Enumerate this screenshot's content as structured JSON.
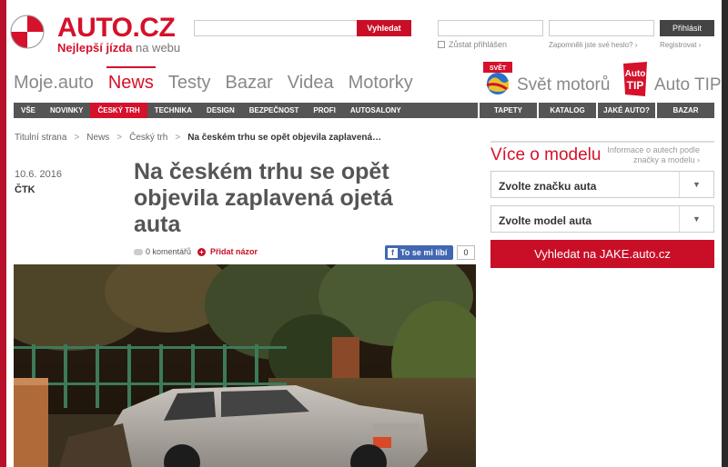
{
  "header": {
    "logo_text": "AUTO.CZ",
    "tagline_bold": "Nejlepší jízda",
    "tagline_light": " na webu",
    "search_button": "Vyhledat",
    "login_button": "Přihlásit",
    "remember_label": "Zůstat přihlášen",
    "forgot_label": "Zapomněli jste své heslo? ›",
    "register_label": "Registrovat ›"
  },
  "main_nav": {
    "items": [
      "Moje.auto",
      "News",
      "Testy",
      "Bazar",
      "Videa",
      "Motorky"
    ],
    "active": "News",
    "svet_label": "Svět motorů",
    "svet_logo_top": "SVĚT",
    "autotip_label": "Auto TIP",
    "autotip_logo_top": "Auto",
    "autotip_logo_bottom": "TIP"
  },
  "sub_nav": {
    "items": [
      "VŠE",
      "NOVINKY",
      "ČESKÝ TRH",
      "TECHNIKA",
      "DESIGN",
      "BEZPEČNOST",
      "PROFI",
      "AUTOSALONY"
    ],
    "active": "ČESKÝ TRH",
    "right_items": [
      "TAPETY",
      "KATALOG",
      "JAKÉ AUTO?",
      "BAZAR"
    ]
  },
  "breadcrumb": {
    "items": [
      "Titulní strana",
      "News",
      "Český trh"
    ],
    "current": "Na českém trhu se opět objevila zaplavená…"
  },
  "article": {
    "date": "10.6. 2016",
    "author": "ČTK",
    "title": "Na českém trhu se opět objevila zaplavená ojetá auta",
    "comments": "0 komentářů",
    "add_opinion": "Přidat názor",
    "like_label": "To se mi líbí",
    "like_count": "0"
  },
  "sidebar": {
    "title": "Více o modelu",
    "info": "Informace o autech podle značky a modelu ›",
    "brand_select": "Zvolte značku auta",
    "model_select": "Zvolte model auta",
    "search_button": "Vyhledat na JAKE.auto.cz"
  },
  "colors": {
    "brand_red": "#d5112b",
    "nav_gray": "#555555",
    "background_red": "#b8102a"
  }
}
